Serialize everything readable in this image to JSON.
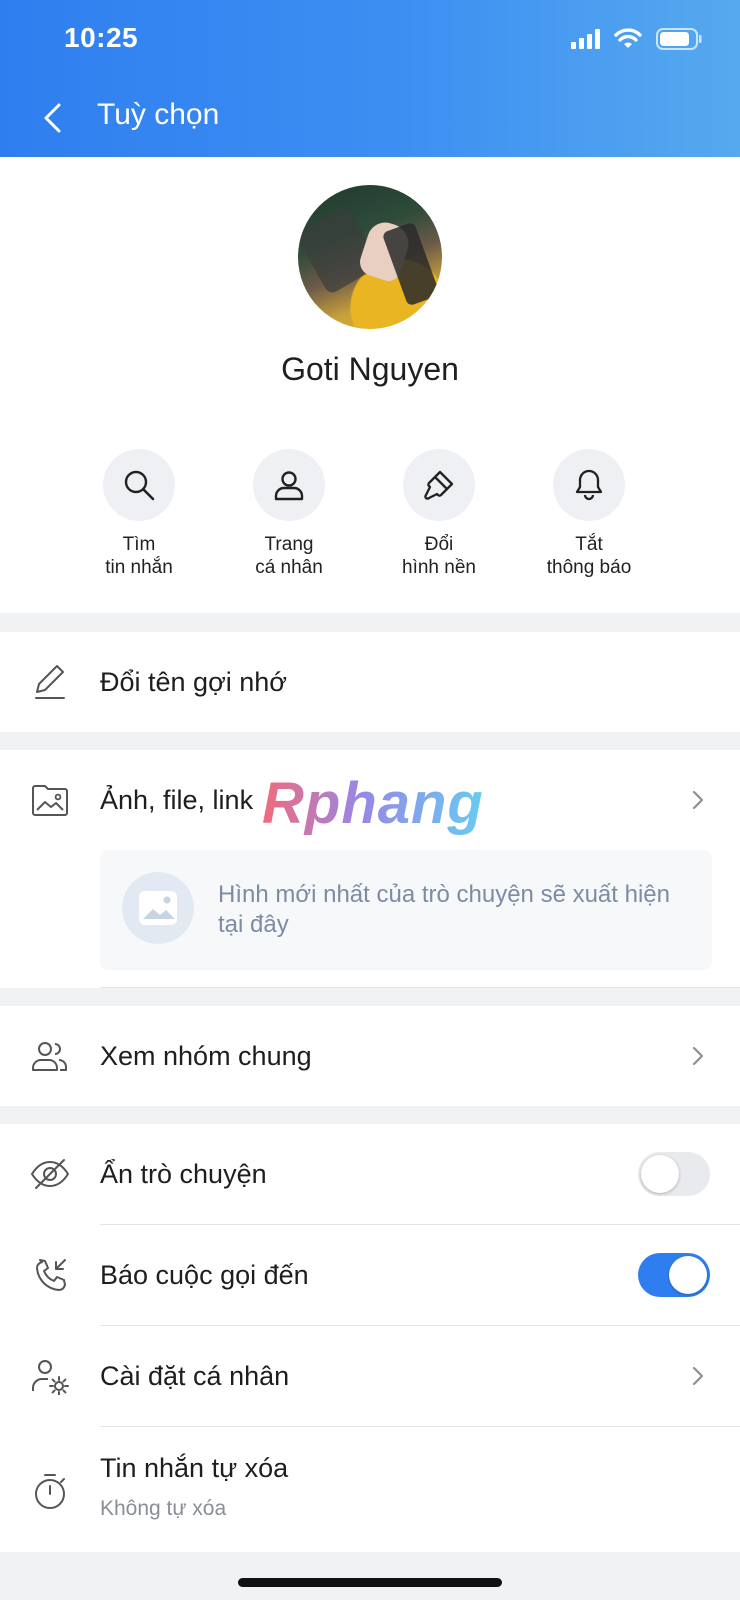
{
  "status_bar": {
    "time": "10:25"
  },
  "header": {
    "title": "Tuỳ chọn"
  },
  "profile": {
    "name": "Goti Nguyen"
  },
  "actions": [
    {
      "line1": "Tìm",
      "line2": "tin nhắn",
      "icon": "search-icon"
    },
    {
      "line1": "Trang",
      "line2": "cá nhân",
      "icon": "person-icon"
    },
    {
      "line1": "Đổi",
      "line2": "hình nền",
      "icon": "paint-brush-icon"
    },
    {
      "line1": "Tắt",
      "line2": "thông báo",
      "icon": "bell-icon"
    }
  ],
  "menu": {
    "rename": "Đổi tên gợi nhớ",
    "media": "Ảnh, file, link",
    "media_placeholder": "Hình mới nhất của trò chuyện sẽ xuất hiện tại đây",
    "groups": "Xem nhóm chung",
    "hide_chat": "Ẩn trò chuyện",
    "call_alert": "Báo cuộc gọi đến",
    "personal_settings": "Cài đặt cá nhân",
    "auto_delete": "Tin nhắn tự xóa",
    "auto_delete_value": "Không tự xóa"
  },
  "toggles": {
    "hide_chat": false,
    "call_alert": true
  },
  "watermark": "Rphang",
  "colors": {
    "accent": "#2f7ef0",
    "header_end": "#56a9ee"
  }
}
